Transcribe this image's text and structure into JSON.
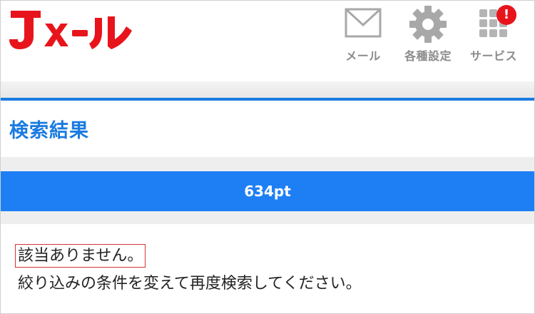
{
  "header": {
    "logo_text": "Jメール",
    "nav": [
      {
        "label": "メール",
        "icon": "mail-icon"
      },
      {
        "label": "各種設定",
        "icon": "gear-icon"
      },
      {
        "label": "サービス",
        "icon": "grid-icon",
        "badge": "!"
      }
    ]
  },
  "page": {
    "title": "検索結果",
    "points": "634pt"
  },
  "result": {
    "no_result": "該当ありません。",
    "hint": "絞り込みの条件を変えて再度検索してください。"
  },
  "colors": {
    "brand_red": "#e8141c",
    "accent_blue": "#1e7ff5",
    "title_blue": "#1a7be0",
    "icon_gray": "#a8a8a8"
  }
}
